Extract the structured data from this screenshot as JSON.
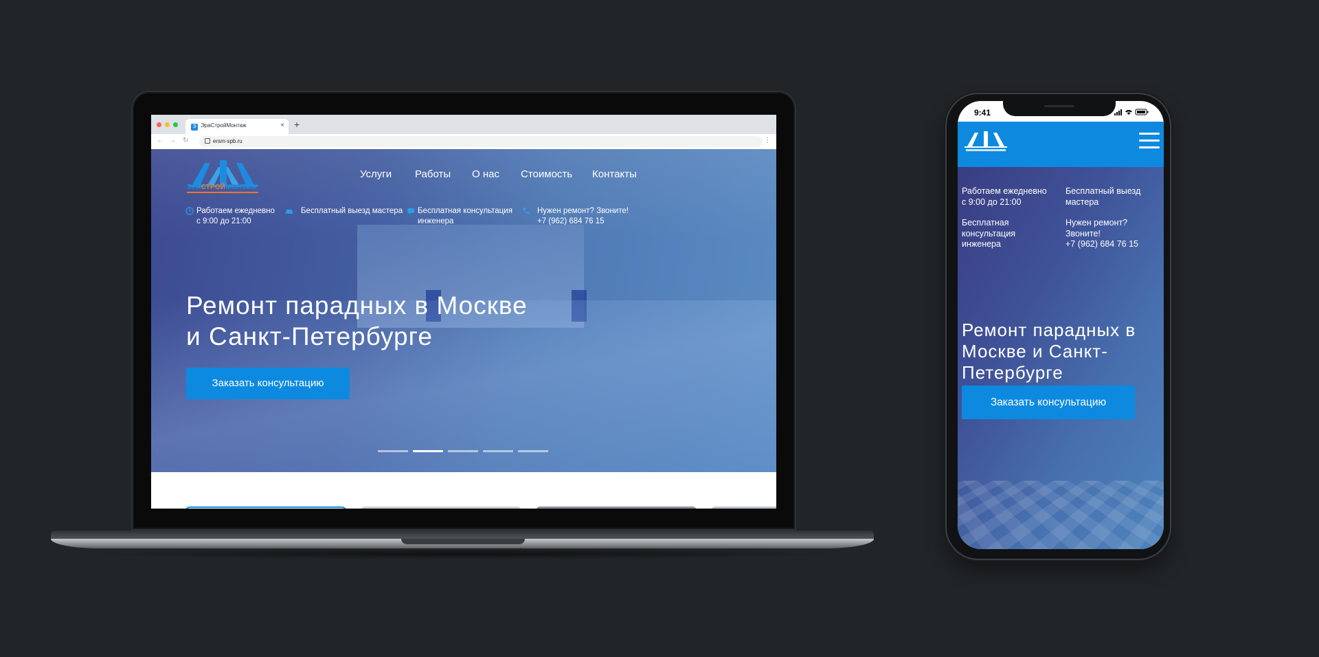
{
  "browser": {
    "tab_title": "ЭраСтройМонтаж",
    "favicon_letter": "Э",
    "tab_close": "×",
    "new_tab": "+",
    "url": "ersm-spb.ru",
    "back": "←",
    "forward": "→",
    "reload": "↻",
    "menu": "⋮"
  },
  "logo": {
    "part1": "ЭРА",
    "part2": "СТРОЙ",
    "part3": "МОНТАЖ",
    "part3_color": "#1d8ce0"
  },
  "nav": {
    "items": [
      "Услуги",
      "Работы",
      "О нас",
      "Стоимость",
      "Контакты"
    ]
  },
  "info": {
    "hours_line1": "Работаем ежедневно",
    "hours_line2": "с 9:00 до 21:00",
    "visit": "Бесплатный выезд мастера",
    "consult_line1": "Бесплатная консультация",
    "consult_line2": "инженера",
    "call_line1": "Нужен ремонт? Звоните!",
    "phone": "+7 (962) 684 76 15"
  },
  "hero": {
    "title_line1": "Ремонт парадных в Москве",
    "title_line2": "и Санкт-Петербурге",
    "cta": "Заказать консультацию",
    "slides_total": 5,
    "active_slide": 2
  },
  "phone": {
    "time": "9:41",
    "info": {
      "hours_line1": "Работаем ежедневно",
      "hours_line2": "с 9:00 до 21:00",
      "visit_line1": "Бесплатный выезд",
      "visit_line2": "мастера",
      "consult_line1": "Бесплатная",
      "consult_line2": "консультация",
      "consult_line3": "инженера",
      "call_line1": "Нужен ремонт?",
      "call_line2": "Звоните!",
      "phone": "+7 (962) 684 76 15"
    },
    "title_line1": "Ремонт парадных в",
    "title_line2": "Москве и Санкт-",
    "title_line3": "Петербурге",
    "cta": "Заказать консультацию"
  },
  "colors": {
    "background": "#212527",
    "accent_blue": "#0d8ae0",
    "logo_orange": "#e9792a"
  }
}
